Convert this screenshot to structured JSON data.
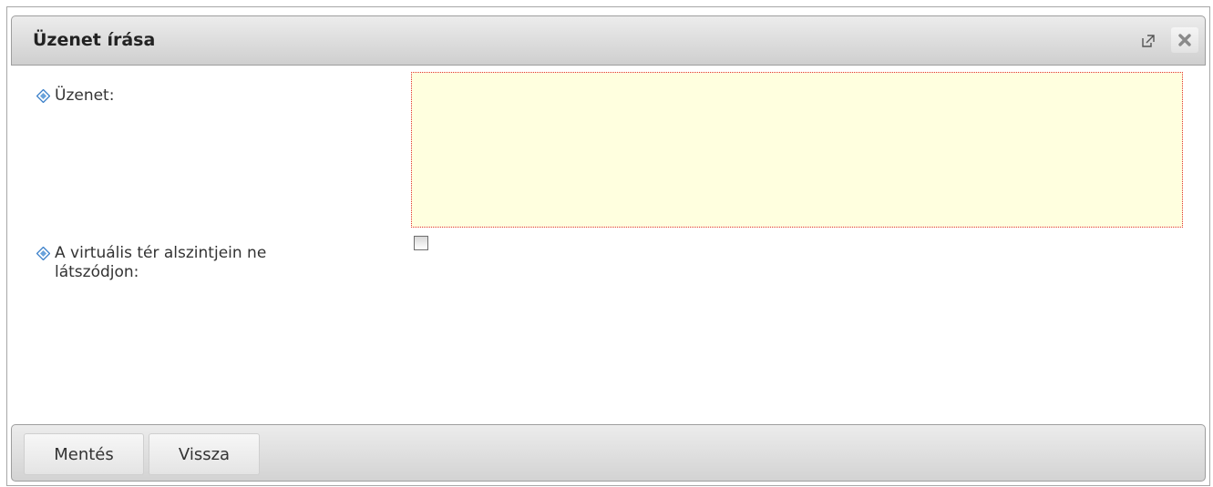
{
  "dialog": {
    "title": "Üzenet írása",
    "popout_icon": "popout-icon",
    "close_icon": "close-icon"
  },
  "form": {
    "message_label": "Üzenet:",
    "message_value": "",
    "hide_label": "A virtuális tér alszintjein ne látszódjon:",
    "hide_checked": false,
    "bullet_icon": "diamond-bullet-icon"
  },
  "footer": {
    "save_label": "Mentés",
    "back_label": "Vissza"
  },
  "colors": {
    "field_background": "#ffffdf",
    "field_error_border": "#e23030",
    "bullet": "#3a7fc9"
  }
}
